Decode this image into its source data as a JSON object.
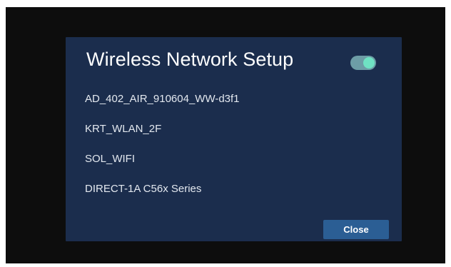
{
  "dialog": {
    "title": "Wireless Network Setup",
    "wifi_toggle": {
      "state": "on"
    },
    "networks": [
      {
        "ssid": "AD_402_AIR_910604_WW-d3f1"
      },
      {
        "ssid": "KRT_WLAN_2F"
      },
      {
        "ssid": "SOL_WIFI"
      },
      {
        "ssid": "DIRECT-1A C56x Series"
      }
    ],
    "close_label": "Close"
  },
  "colors": {
    "background": "#0d0d0d",
    "dialog": "#1b2d4d",
    "toggle_track": "#6d9da6",
    "toggle_knob": "#6fe2c3",
    "button": "#2b5e94"
  }
}
